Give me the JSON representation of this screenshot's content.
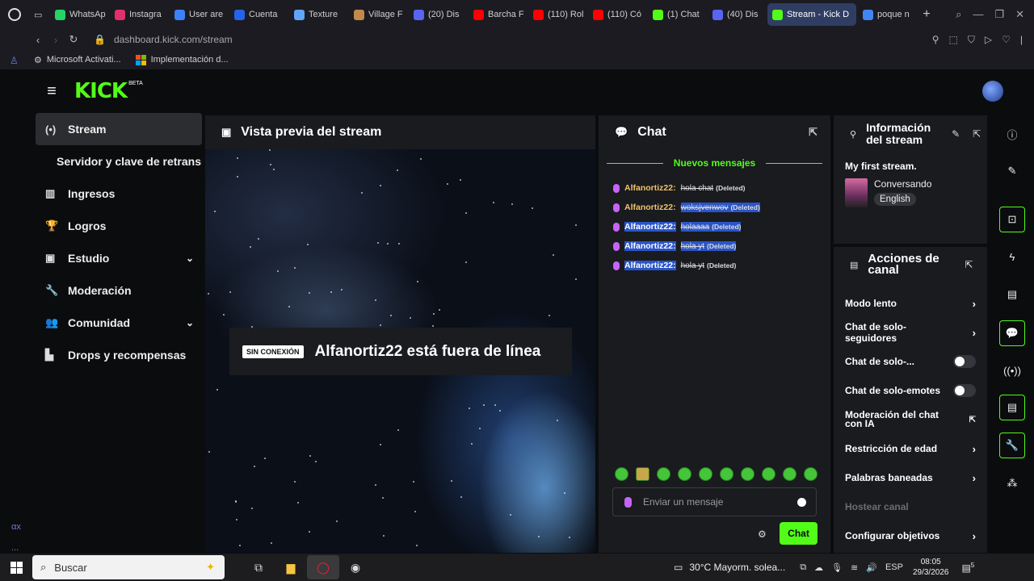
{
  "browser": {
    "tabs": [
      {
        "label": "WhatsAp",
        "color": "#25d366"
      },
      {
        "label": "Instagra",
        "color": "#e1306c"
      },
      {
        "label": "User are",
        "color": "#3b82f6"
      },
      {
        "label": "Cuenta",
        "color": "#2563eb"
      },
      {
        "label": "Texture",
        "color": "#60a5fa"
      },
      {
        "label": "Village F",
        "color": "#c08a4a"
      },
      {
        "label": "(20) Dis",
        "color": "#5865f2"
      },
      {
        "label": "Barcha F",
        "color": "#ff0000"
      },
      {
        "label": "(110) Rol",
        "color": "#ff0000"
      },
      {
        "label": "(110) Có",
        "color": "#ff0000"
      },
      {
        "label": "(1) Chat",
        "color": "#53fc18"
      },
      {
        "label": "(40) Dis",
        "color": "#5865f2"
      },
      {
        "label": "Stream - Kick D",
        "color": "#53fc18",
        "active": true
      },
      {
        "label": "poque n",
        "color": "#4285f4"
      }
    ],
    "url": "dashboard.kick.com/stream",
    "bookmarks": [
      {
        "label": "Microsoft Activati...",
        "icon": "gear-icon"
      },
      {
        "label": "Implementación d...",
        "icon": "microsoft-icon"
      }
    ]
  },
  "header": {
    "logo": "KICK",
    "beta": "BETA"
  },
  "nav": {
    "items": [
      {
        "label": "Stream",
        "icon": "broadcast-icon",
        "glyph": "(•)",
        "active": true
      },
      {
        "label": "Servidor y clave de retransmisión",
        "icon": "",
        "glyph": "",
        "sub": true
      },
      {
        "label": "Ingresos",
        "icon": "chart-icon",
        "glyph": "▥"
      },
      {
        "label": "Logros",
        "icon": "trophy-icon",
        "glyph": "🏆"
      },
      {
        "label": "Estudio",
        "icon": "studio-icon",
        "glyph": "▣",
        "chevron": true
      },
      {
        "label": "Moderación",
        "icon": "wrench-icon",
        "glyph": "🔧"
      },
      {
        "label": "Comunidad",
        "icon": "community-icon",
        "glyph": "👥",
        "chevron": true
      },
      {
        "label": "Drops y recompensas",
        "icon": "drops-icon",
        "glyph": "▙"
      }
    ],
    "bottom_marks": [
      "αx",
      "..."
    ]
  },
  "preview": {
    "title": "Vista previa del stream",
    "offline_badge": "SIN CONEXIÓN",
    "offline_text": "Alfanortiz22 está fuera de línea"
  },
  "chat": {
    "title": "Chat",
    "new_messages": "Nuevos mensajes",
    "messages": [
      {
        "user": "Alfanortiz22:",
        "text": "hola chat",
        "deleted": "(Deleted)",
        "hl_user": false,
        "hl_text": false
      },
      {
        "user": "Alfanortiz22:",
        "text": "woksjvenwov",
        "deleted": "(Deleted)",
        "hl_user": false,
        "hl_text": true
      },
      {
        "user": "Alfanortiz22:",
        "text": "holaaaa",
        "deleted": "(Deleted)",
        "hl_user": true,
        "hl_text": true
      },
      {
        "user": "Alfanortiz22:",
        "text": "hola yt",
        "deleted": "(Deleted)",
        "hl_user": true,
        "hl_text": true
      },
      {
        "user": "Alfanortiz22:",
        "text": "hola yt",
        "deleted": "(Deleted)",
        "hl_user": true,
        "hl_text": false
      }
    ],
    "input_placeholder": "Enviar un mensaje",
    "send_label": "Chat"
  },
  "stream_info": {
    "title": "Información del stream",
    "stream_title": "My first stream.",
    "category": "Conversando",
    "language": "English"
  },
  "channel_actions": {
    "title": "Acciones de canal",
    "items": [
      {
        "label": "Modo lento",
        "kind": "arrow"
      },
      {
        "label": "Chat de solo-seguidores",
        "kind": "arrow"
      },
      {
        "label": "Chat de solo-...",
        "kind": "toggle"
      },
      {
        "label": "Chat de solo-emotes",
        "kind": "toggle"
      },
      {
        "label": "Moderación del chat con IA",
        "kind": "external"
      },
      {
        "label": "Restricción de edad",
        "kind": "arrow"
      },
      {
        "label": "Palabras baneadas",
        "kind": "arrow"
      },
      {
        "label": "Hostear canal",
        "kind": "disabled"
      },
      {
        "label": "Configurar objetivos",
        "kind": "arrow"
      }
    ]
  },
  "taskbar": {
    "search": "Buscar",
    "weather": "30°C  Mayorm. solea...",
    "lang": "ESP",
    "time": "08:05",
    "date": "29/3/2026",
    "notif_count": "5"
  }
}
